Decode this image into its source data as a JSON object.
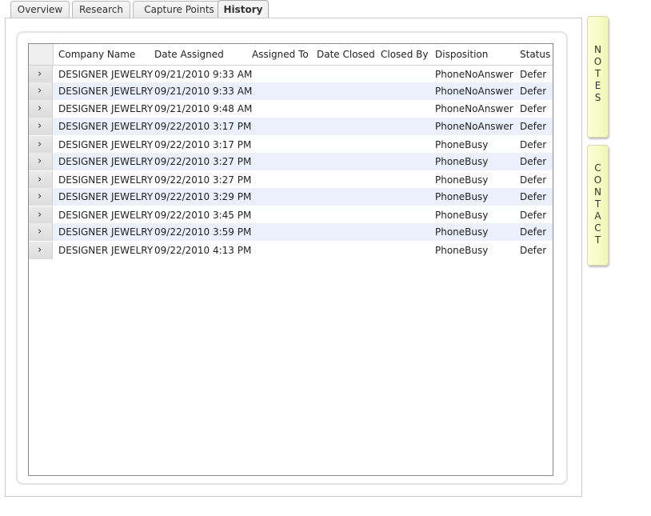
{
  "tabs": [
    {
      "label": "Overview",
      "active": false
    },
    {
      "label": "Research",
      "active": false
    },
    {
      "label": "Capture Points",
      "active": false
    },
    {
      "label": "History",
      "active": true
    }
  ],
  "grid": {
    "columns": [
      "Company Name",
      "Date Assigned",
      "Assigned To",
      "Date Closed",
      "Closed By",
      "Disposition",
      "Status"
    ],
    "rows": [
      {
        "company": "DESIGNER JEWELRY",
        "date_assigned": "09/21/2010 9:33 AM",
        "assigned_to": "",
        "date_closed": "",
        "closed_by": "",
        "disposition": "PhoneNoAnswer",
        "status": "Defer"
      },
      {
        "company": "DESIGNER JEWELRY",
        "date_assigned": "09/21/2010 9:33 AM",
        "assigned_to": "",
        "date_closed": "",
        "closed_by": "",
        "disposition": "PhoneNoAnswer",
        "status": "Defer"
      },
      {
        "company": "DESIGNER JEWELRY",
        "date_assigned": "09/21/2010 9:48 AM",
        "assigned_to": "",
        "date_closed": "",
        "closed_by": "",
        "disposition": "PhoneNoAnswer",
        "status": "Defer"
      },
      {
        "company": "DESIGNER JEWELRY",
        "date_assigned": "09/22/2010 3:17 PM",
        "assigned_to": "",
        "date_closed": "",
        "closed_by": "",
        "disposition": "PhoneNoAnswer",
        "status": "Defer"
      },
      {
        "company": "DESIGNER JEWELRY",
        "date_assigned": "09/22/2010 3:17 PM",
        "assigned_to": "",
        "date_closed": "",
        "closed_by": "",
        "disposition": "PhoneBusy",
        "status": "Defer"
      },
      {
        "company": "DESIGNER JEWELRY",
        "date_assigned": "09/22/2010 3:27 PM",
        "assigned_to": "",
        "date_closed": "",
        "closed_by": "",
        "disposition": "PhoneBusy",
        "status": "Defer"
      },
      {
        "company": "DESIGNER JEWELRY",
        "date_assigned": "09/22/2010 3:27 PM",
        "assigned_to": "",
        "date_closed": "",
        "closed_by": "",
        "disposition": "PhoneBusy",
        "status": "Defer"
      },
      {
        "company": "DESIGNER JEWELRY",
        "date_assigned": "09/22/2010 3:29 PM",
        "assigned_to": "",
        "date_closed": "",
        "closed_by": "",
        "disposition": "PhoneBusy",
        "status": "Defer"
      },
      {
        "company": "DESIGNER JEWELRY",
        "date_assigned": "09/22/2010 3:45 PM",
        "assigned_to": "",
        "date_closed": "",
        "closed_by": "",
        "disposition": "PhoneBusy",
        "status": "Defer"
      },
      {
        "company": "DESIGNER JEWELRY",
        "date_assigned": "09/22/2010 3:59 PM",
        "assigned_to": "",
        "date_closed": "",
        "closed_by": "",
        "disposition": "PhoneBusy",
        "status": "Defer"
      },
      {
        "company": "DESIGNER JEWELRY",
        "date_assigned": "09/22/2010 4:13 PM",
        "assigned_to": "",
        "date_closed": "",
        "closed_by": "",
        "disposition": "PhoneBusy",
        "status": "Defer"
      }
    ]
  },
  "side_tabs": {
    "notes": {
      "label": "NOTES"
    },
    "contact": {
      "label": "CONTACT"
    }
  },
  "icons": {
    "row_expand": "chevron-right-icon"
  },
  "colors": {
    "alt_row": "#eaf1fc",
    "side_tab": "#f4f9c4"
  }
}
